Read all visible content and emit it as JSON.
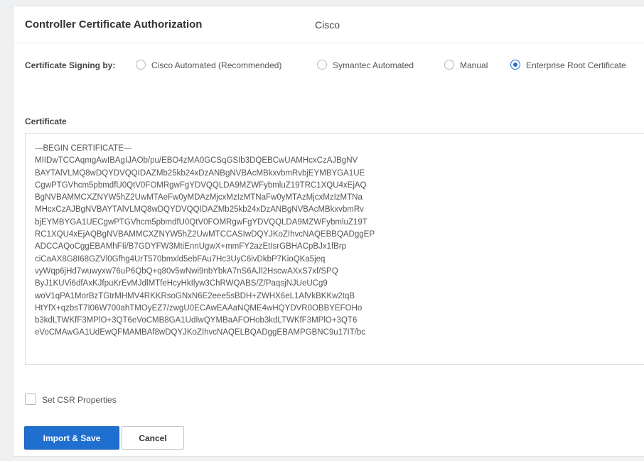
{
  "header": {
    "title": "Controller Certificate Authorization",
    "value": "Cisco"
  },
  "signing": {
    "label": "Certificate Signing by:",
    "options": [
      {
        "label": "Cisco Automated (Recommended)",
        "selected": false
      },
      {
        "label": "Symantec Automated",
        "selected": false
      },
      {
        "label": "Manual",
        "selected": false
      },
      {
        "label": "Enterprise Root Certificate",
        "selected": true
      }
    ]
  },
  "certificate": {
    "label": "Certificate",
    "lines": [
      "—BEGIN CERTIFICATE—",
      "MIIDwTCCAqmgAwIBAgIJAOb/pu/EBO4zMA0GCSqGSIb3DQEBCwUAMHcxCzAJBgNV",
      "BAYTAlVLMQ8wDQYDVQQIDAZMb25kb24xDzANBgNVBAcMBkxvbmRvbjEYMBYGA1UE",
      "CgwPTGVhcm5pbmdfU0QtV0FOMRgwFgYDVQQLDA9MZWFybmluZ19TRC1XQU4xEjAQ",
      "BgNVBAMMCXZNYW5hZ2UwMTAeFw0yMDAzMjcxMzIzMTNaFw0yMTAzMjcxMzIzMTNa",
      "MHcxCzAJBgNVBAYTAlVLMQ8wDQYDVQQIDAZMb25kb24xDzANBgNVBAcMBkxvbmRv",
      "bjEYMBYGA1UECgwPTGVhcm5pbmdfU0QtV0FOMRgwFgYDVQQLDA9MZWFybmluZ19T",
      "RC1XQU4xEjAQBgNVBAMMCXZNYW5hZ2UwMTCCASIwDQYJKoZIhvcNAQEBBQADggEP",
      "ADCCAQoCggEBAMhFIi/B7GDYFW3MtiEnnUgwX+mmFY2azEtIsrGBHACpBJx1fBrp",
      "ciCaAX8G8I68GZVl0Gfhg4UrT570bmxld5ebFAu7Hc3UyC6ivDkbP7KioQKa5jeq",
      "vyWqp6jHd7wuwyxw76uP6QbQ+q80v5wNwi9nbYbkA7nS6AJl2HscwAXxS7xf/SPQ",
      "ByJ1KUVi6dfAxKJfpuKrEvMJdlMTfeHcyHkIlyw3ChRWQABS/Z/PaqsjNJUeUCg9",
      "woV1qPA1MorBzTGtrMHMV4RKKRsoGNxN6E2eee5sBDH+ZWHX6eL1AlVkBKKw2tqB",
      "HtYfX+qzbsT7I06W700ahTMOyEZ7/zwgU0ECAwEAAaNQME4wHQYDVR0OBBYEFOHo",
      "b3kdLTWKfF3MPlO+3QT6eVoCMB8GA1UdIwQYMBaAFOHob3kdLTWKfF3MPlO+3QT6",
      "eVoCMAwGA1UdEwQFMAMBAf8wDQYJKoZIhvcNAQELBQADggEBAMPGBNC9u17IT/bc"
    ]
  },
  "csr": {
    "label": "Set CSR Properties",
    "checked": false
  },
  "buttons": {
    "import_save": "Import & Save",
    "cancel": "Cancel"
  },
  "colors": {
    "accent": "#1f6fd0",
    "background": "#eef0f2"
  }
}
